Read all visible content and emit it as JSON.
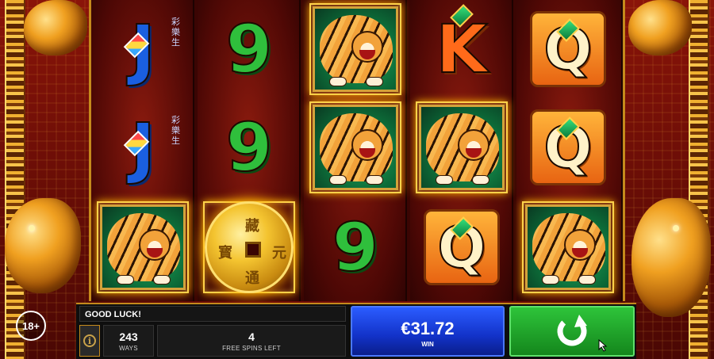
{
  "message": "GOOD LUCK!",
  "info_icon": "info-icon",
  "ways": {
    "value": "243",
    "label": "WAYS"
  },
  "free_spins": {
    "value": "4",
    "label": "FREE SPINS LEFT"
  },
  "win": {
    "amount": "€31.72",
    "label": "WIN"
  },
  "spin_icon": "spin-arrow-icon",
  "age": {
    "badge": "18+",
    "note": ""
  },
  "reels": [
    [
      "J",
      "J",
      "tiger"
    ],
    [
      "9",
      "9",
      "coin"
    ],
    [
      "tiger",
      "tiger",
      "9"
    ],
    [
      "K",
      "tiger",
      "Q"
    ],
    [
      "Q",
      "Q",
      "tiger"
    ]
  ],
  "coin_glyphs": [
    "藏",
    "元",
    "寳",
    "通"
  ],
  "colors": {
    "spin_green": "#2ec43a",
    "win_blue": "#2b5cff",
    "gold": "#c58a1c"
  }
}
